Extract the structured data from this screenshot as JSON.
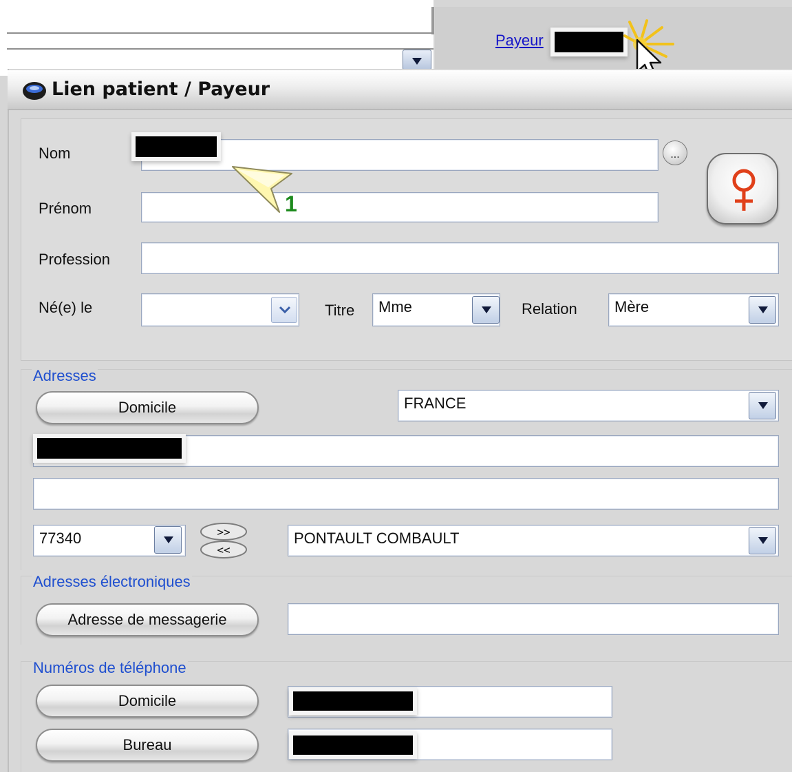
{
  "background": {
    "payeur_link": "Payeur"
  },
  "dialog": {
    "title": "Lien patient / Payeur"
  },
  "identity": {
    "nom_label": "Nom",
    "prenom_label": "Prénom",
    "profession_label": "Profession",
    "ne_le_label": "Né(e) le",
    "titre_label": "Titre",
    "titre_value": "Mme",
    "relation_label": "Relation",
    "relation_value": "Mère",
    "more_button": "..."
  },
  "callout": {
    "number": "1"
  },
  "adresses": {
    "section_label": "Adresses",
    "type_button": "Domicile",
    "country_value": "FRANCE",
    "postal_code": "77340",
    "city": "PONTAULT COMBAULT"
  },
  "email": {
    "section_label": "Adresses électroniques",
    "button": "Adresse de messagerie"
  },
  "phones": {
    "section_label": "Numéros de téléphone",
    "home_button": "Domicile",
    "office_button": "Bureau"
  },
  "colors": {
    "link": "#1515c8",
    "section_label": "#1f4fcf",
    "female_symbol": "#e0401a",
    "callout_number": "#1c8a1c"
  }
}
